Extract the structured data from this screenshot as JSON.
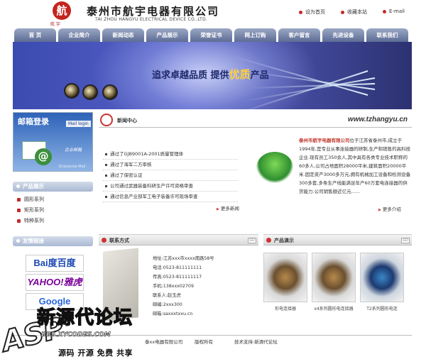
{
  "header": {
    "logo_char": "航",
    "logo_sub": "航  宇",
    "company_name": "泰州市航宇电器有限公司",
    "company_name_en": "TAI ZHOU HANGYU ELECTRICAL DEVICE CO.,LTD.",
    "links": [
      "设为首页",
      "收藏本站",
      "E-mail"
    ]
  },
  "nav": {
    "items": [
      "首 页",
      "企业简介",
      "新闻动态",
      "产品展示",
      "荣誉证书",
      "网上订购",
      "客户留言",
      "先进设备",
      "联系我们"
    ]
  },
  "banner": {
    "slogan_a": "追求卓越品质",
    "slogan_b": "提供",
    "slogan_c": "优质",
    "slogan_d": "产品"
  },
  "mailbox": {
    "title": "邮箱登录",
    "login": "Mail login",
    "email_label": "企业邮箱",
    "bottom": "Enterprise Mail"
  },
  "sidebar": {
    "products_title": "产品展示",
    "products": [
      "圆形系列",
      "矩形系列",
      "特种系列"
    ],
    "links_title": "友情链接",
    "friend_links": [
      "Bai度百度",
      "YAHOO!雅虎",
      "Google"
    ]
  },
  "news": {
    "title": "新闻中心",
    "url": "www.tzhangyu.cn",
    "items": [
      "通过了GJB9001A-2001质量管理体",
      "通过了海军二方审核",
      "通过了保密认证",
      "公司通过武器装备科研生产许可资格审查",
      "通过信息产业部军工电子装备许可现场审查"
    ],
    "more": "更多新闻"
  },
  "intro": {
    "company": "泰州市航宇电器有限公司",
    "text": "位于江苏省泰州市,成立于1994年,是专业从事连接器的研制,生产和销售的高科技企业.现有员工350余人,其中具有各类专业技术职称的60多人,公司占地面积28000平米,建筑面积20000平米.固定资产3000多万元,拥有机械加工设备和检测设备300多套,多条生产线能满足年产60万套电连接器的供货能力.公司销售额近亿元......",
    "more": "更多介绍"
  },
  "contact": {
    "title": "联系方式",
    "go": "GO",
    "lines": [
      "地址:江苏xxx市xxxx南路58号",
      "电话:0523-811111111",
      "传真:0523-811111117",
      "手机:138xxx02709",
      "联系人:赵玉虎",
      "邮编:2xxx300",
      "邮箱:saxxxtxxu.cn"
    ]
  },
  "products_show": {
    "title": "产品演示",
    "go": "GO",
    "captions": [
      "形电连接器",
      "x4系列圆形电连接器",
      "T2系列圆形电连"
    ]
  },
  "footer": {
    "copyright": "泰xx电器有限公司",
    "rights": "版权所有",
    "support": "技术支持:新源代论坛"
  },
  "watermark": {
    "big": "新源代论坛",
    "asp": "ASP",
    "url": "BBS.XYCODES.COM",
    "slogan": "源码 开源 免费 共享"
  },
  "colors": {
    "nav": "#6f7da3",
    "banner": "#4a55b8",
    "accent": "#c62828"
  }
}
